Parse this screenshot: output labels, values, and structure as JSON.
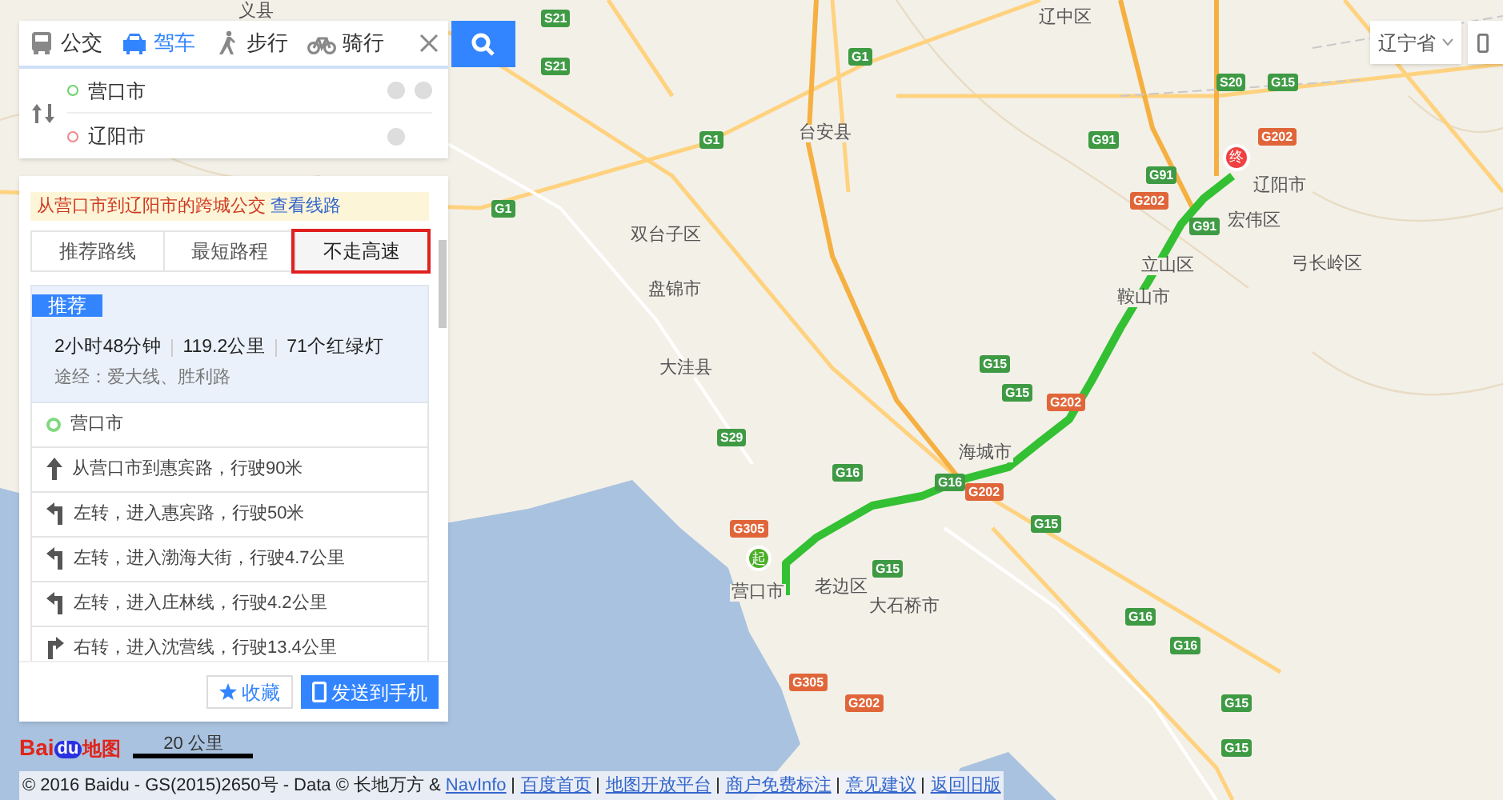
{
  "modes": [
    {
      "kind": "bus",
      "label": "公交",
      "selected": false
    },
    {
      "kind": "car",
      "label": "驾车",
      "selected": true
    },
    {
      "kind": "walk",
      "label": "步行",
      "selected": false
    },
    {
      "kind": "bike",
      "label": "骑行",
      "selected": false
    }
  ],
  "route_inputs": {
    "start": "营口市",
    "end": "辽阳市"
  },
  "notice": {
    "text": "从营口市到辽阳市的跨城公交",
    "link": "查看线路"
  },
  "strategy_tabs": [
    {
      "label": "推荐路线",
      "selected": false
    },
    {
      "label": "最短路程",
      "selected": false
    },
    {
      "label": "不走高速",
      "selected": true
    }
  ],
  "plan": {
    "badge": "推荐",
    "duration": "2小时48分钟",
    "distance": "119.2公里",
    "lights": "71个红绿灯",
    "via": "途经：爱大线、胜利路"
  },
  "steps": [
    {
      "kind": "start",
      "text": "营口市"
    },
    {
      "kind": "straight",
      "text": "从营口市到惠宾路，行驶90米"
    },
    {
      "kind": "left",
      "text": "左转，进入惠宾路，行驶50米"
    },
    {
      "kind": "left",
      "text": "左转，进入渤海大街，行驶4.7公里"
    },
    {
      "kind": "left",
      "text": "左转，进入庄林线，行驶4.2公里"
    },
    {
      "kind": "right",
      "text": "右转，进入沈营线，行驶13.4公里"
    }
  ],
  "actions": [
    {
      "kind": "star",
      "label": "收藏"
    },
    {
      "kind": "phone",
      "label": "发送到手机"
    }
  ],
  "region_selector": "辽宁省",
  "map": {
    "labels": [
      "义县",
      "辽中区",
      "台安县",
      "双台子区",
      "盘锦市",
      "大洼县",
      "营口市",
      "老边区",
      "大石桥市",
      "海城市",
      "鞍山市",
      "立山区",
      "辽阳市",
      "宏伟区",
      "弓长岭区"
    ],
    "shields": [
      "S21",
      "S21",
      "G1",
      "G1",
      "G1",
      "S20",
      "G15",
      "G91",
      "G91",
      "G202",
      "G202",
      "G91",
      "G15",
      "G15",
      "G202",
      "S29",
      "G16",
      "G16",
      "G202",
      "G15",
      "G305",
      "G15",
      "G305",
      "G202",
      "G16",
      "G16",
      "G15",
      "G15"
    ],
    "start_marker": "起",
    "end_marker": "终"
  },
  "logo": {
    "bai": "Bai",
    "du": "du",
    "map": "地图"
  },
  "scale": "20 公里",
  "footer": {
    "copyright": "© 2016 Baidu - GS(2015)2650号 - Data © 长地万方 &",
    "links": [
      "NavInfo",
      "百度首页",
      "地图开放平台",
      "商户免费标注",
      "意见建议",
      "返回旧版"
    ]
  }
}
